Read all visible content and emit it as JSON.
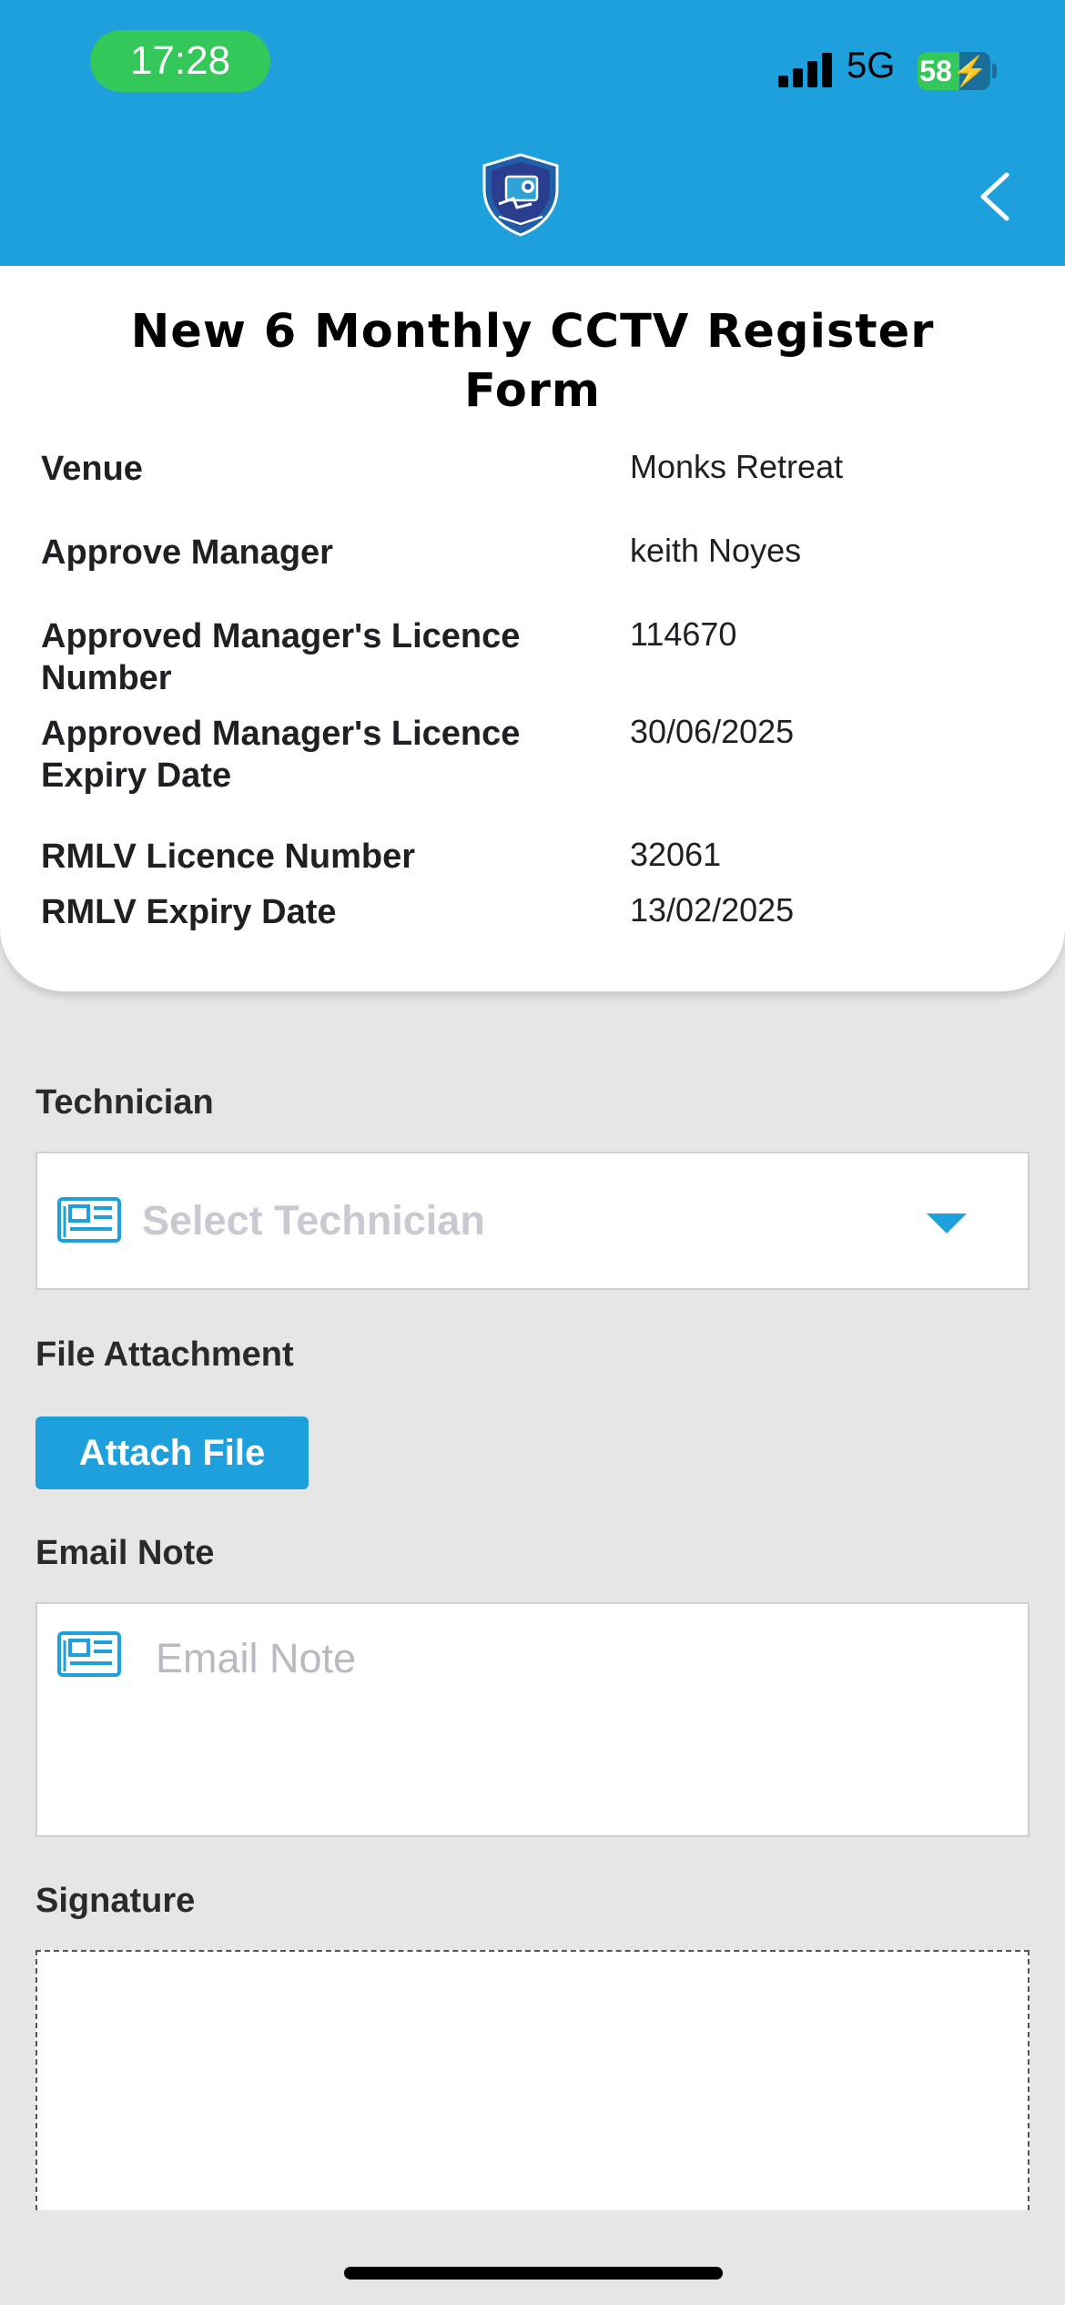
{
  "status_bar": {
    "time": "17:28",
    "network": "5G",
    "battery": "58"
  },
  "form": {
    "title": "New 6 Monthly CCTV Register Form",
    "details": [
      {
        "label": "Venue",
        "value": "Monks Retreat"
      },
      {
        "label": "Approve Manager",
        "value": "keith Noyes"
      },
      {
        "label": "Approved Manager's Licence Number",
        "value": "114670"
      },
      {
        "label": "Approved Manager's Licence Expiry Date",
        "value": "30/06/2025"
      },
      {
        "label": "RMLV Licence Number",
        "value": "32061"
      },
      {
        "label": "RMLV Expiry Date",
        "value": "13/02/2025"
      }
    ]
  },
  "technician": {
    "label": "Technician",
    "placeholder": "Select Technician"
  },
  "attachment": {
    "label": "File Attachment",
    "button": "Attach File"
  },
  "email_note": {
    "label": "Email Note",
    "placeholder": "Email Note"
  },
  "signature": {
    "label": "Signature"
  },
  "colors": {
    "header": "#1da0dc",
    "accent": "#1da0dc",
    "status_pill": "#34c759",
    "background": "#e6e6e6"
  }
}
